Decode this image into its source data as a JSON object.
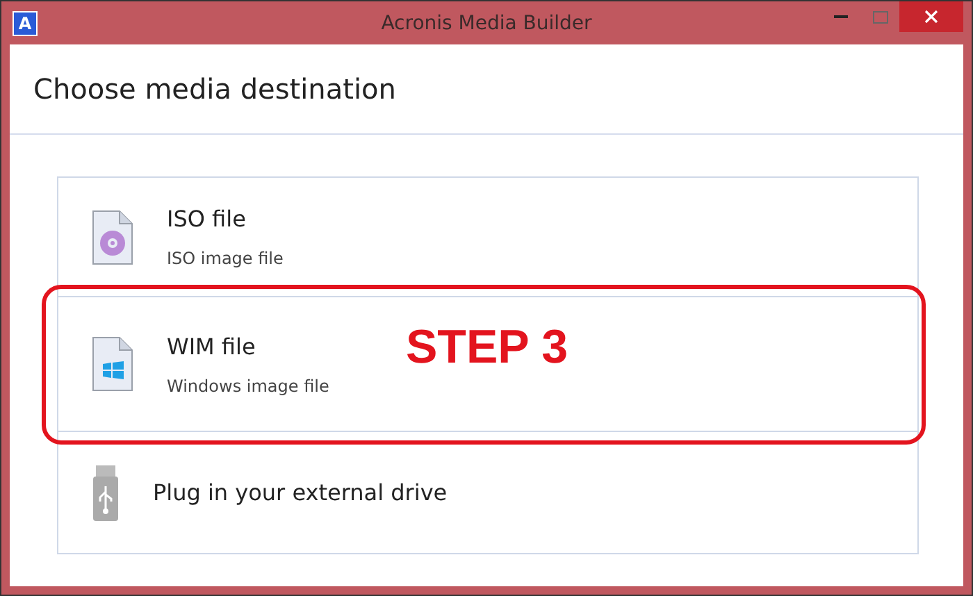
{
  "window": {
    "title": "Acronis Media Builder",
    "app_icon": "A"
  },
  "header": {
    "title": "Choose media destination"
  },
  "options": [
    {
      "kind": "iso",
      "title": "ISO file",
      "subtitle": "ISO image file"
    },
    {
      "kind": "wim",
      "title": "WIM file",
      "subtitle": "Windows image file",
      "annotated": true
    },
    {
      "kind": "usb",
      "title": "Plug in your external drive"
    }
  ],
  "annotation": {
    "text": "STEP 3"
  }
}
